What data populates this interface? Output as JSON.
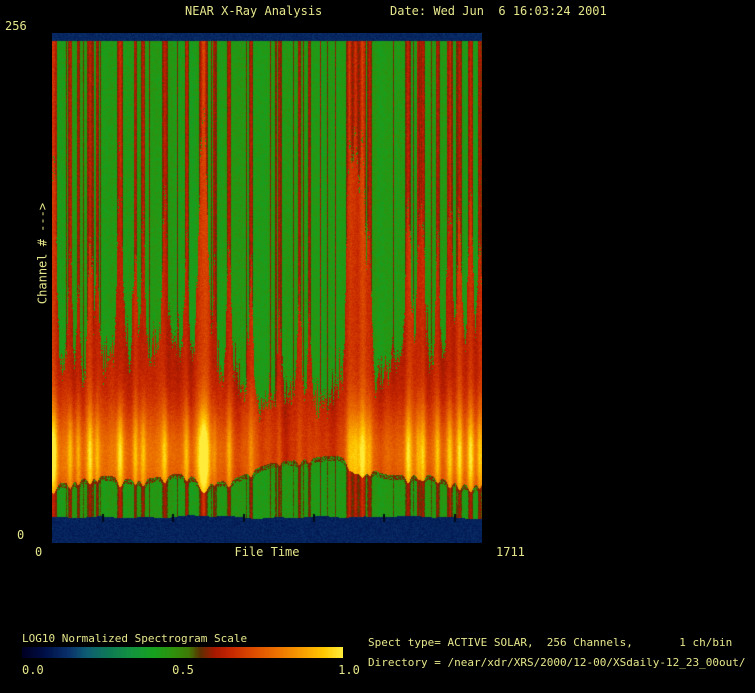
{
  "header": {
    "title": "NEAR X-Ray Analysis",
    "date": "Date: Wed Jun  6 16:03:24 2001"
  },
  "plot": {
    "y_axis": {
      "label": "Channel # --->",
      "max_tick": "256",
      "min_tick": "0"
    },
    "x_axis": {
      "label": "File Time",
      "min_tick": "0",
      "max_tick": "1711"
    }
  },
  "colorbar": {
    "title": "LOG10 Normalized Spectrogram Scale",
    "tick_labels": [
      "0.0",
      "0.5",
      "1.0"
    ]
  },
  "info": {
    "line1": "Spect type= ACTIVE SOLAR,  256 Channels,       1 ch/bin",
    "line2": "Directory = /near/xdr/XRS/2000/12-00/XSdaily-12_23_00out/"
  },
  "colors": {
    "background": "#000000",
    "text_yellow": "#e6e68c",
    "top_band_navy": "#0d2c5c",
    "quiet_green": "#1f9e1f",
    "band_red": "#cc2f00",
    "flare_yellow": "#ffec3a"
  },
  "chart_data": {
    "type": "heatmap",
    "title": "NEAR X-Ray Analysis",
    "xlabel": "File Time",
    "ylabel": "Channel #",
    "x_range": [
      0,
      1711
    ],
    "y_range": [
      0,
      256
    ],
    "scale": {
      "label": "LOG10 Normalized Spectrogram Scale",
      "range": [
        0.0,
        1.0
      ],
      "ticks": [
        0.0,
        0.5,
        1.0
      ]
    },
    "colormap_stops": [
      [
        0.0,
        "#000022"
      ],
      [
        0.07,
        "#001048"
      ],
      [
        0.14,
        "#0a2f6a"
      ],
      [
        0.2,
        "#0e5d74"
      ],
      [
        0.27,
        "#0e7a56"
      ],
      [
        0.34,
        "#139440"
      ],
      [
        0.41,
        "#16a11f"
      ],
      [
        0.47,
        "#2f930e"
      ],
      [
        0.52,
        "#3f7a06"
      ],
      [
        0.555,
        "#5c3000"
      ],
      [
        0.6,
        "#a81800"
      ],
      [
        0.65,
        "#c62600"
      ],
      [
        0.72,
        "#dd4d00"
      ],
      [
        0.8,
        "#ee7500"
      ],
      [
        0.88,
        "#f9a200"
      ],
      [
        0.94,
        "#ffc800"
      ],
      [
        1.0,
        "#ffec3a"
      ]
    ],
    "bands": {
      "top_blue_gap_channels": [
        252,
        256
      ],
      "quiet_background_channels": [
        90,
        252
      ],
      "active_emission_channels": [
        32,
        90
      ],
      "lower_quiet_channels": [
        13,
        32
      ],
      "bottom_blue_gap_channels": [
        0,
        13
      ],
      "peak_emission_channel": 44
    },
    "quiet_interval": {
      "center_time": 995,
      "sigma_time": 170
    },
    "flares": [
      {
        "time": 4,
        "strength": 0.8,
        "narrow_w": 1.8,
        "wide_w": 2.8
      },
      {
        "time": 71,
        "strength": 0.5,
        "narrow_w": 1.2,
        "wide_w": 2.0
      },
      {
        "time": 103,
        "strength": 0.38,
        "narrow_w": 1.0,
        "wide_w": 1.8
      },
      {
        "time": 150,
        "strength": 0.55,
        "narrow_w": 1.4,
        "wide_w": 2.2
      },
      {
        "time": 178,
        "strength": 0.42,
        "narrow_w": 1.0,
        "wide_w": 1.8
      },
      {
        "time": 269,
        "strength": 0.7,
        "narrow_w": 1.5,
        "wide_w": 2.4
      },
      {
        "time": 330,
        "strength": 0.4,
        "narrow_w": 1.0,
        "wide_w": 1.8
      },
      {
        "time": 361,
        "strength": 0.5,
        "narrow_w": 1.2,
        "wide_w": 2.0
      },
      {
        "time": 447,
        "strength": 0.55,
        "narrow_w": 1.3,
        "wide_w": 2.2
      },
      {
        "time": 534,
        "strength": 0.45,
        "narrow_w": 1.1,
        "wide_w": 1.9
      },
      {
        "time": 601,
        "strength": 1.0,
        "narrow_w": 2.0,
        "wide_w": 4.2
      },
      {
        "time": 645,
        "strength": 0.3,
        "narrow_w": 0.9,
        "wide_w": 1.6
      },
      {
        "time": 703,
        "strength": 0.5,
        "narrow_w": 1.2,
        "wide_w": 2.0
      },
      {
        "time": 790,
        "strength": 0.45,
        "narrow_w": 1.1,
        "wide_w": 1.9
      },
      {
        "time": 903,
        "strength": 0.3,
        "narrow_w": 0.9,
        "wide_w": 1.6
      },
      {
        "time": 982,
        "strength": 0.4,
        "narrow_w": 1.0,
        "wide_w": 1.8
      },
      {
        "time": 1022,
        "strength": 0.35,
        "narrow_w": 0.9,
        "wide_w": 1.7
      },
      {
        "time": 1182,
        "strength": 0.8,
        "narrow_w": 1.6,
        "wide_w": 2.8
      },
      {
        "time": 1206,
        "strength": 0.75,
        "narrow_w": 1.5,
        "wide_w": 2.5
      },
      {
        "time": 1233,
        "strength": 0.9,
        "narrow_w": 1.8,
        "wide_w": 3.0
      },
      {
        "time": 1262,
        "strength": 0.5,
        "narrow_w": 1.2,
        "wide_w": 2.0
      },
      {
        "time": 1415,
        "strength": 0.6,
        "narrow_w": 1.4,
        "wide_w": 2.3
      },
      {
        "time": 1455,
        "strength": 0.35,
        "narrow_w": 0.9,
        "wide_w": 1.7
      },
      {
        "time": 1474,
        "strength": 0.5,
        "narrow_w": 1.2,
        "wide_w": 2.0
      },
      {
        "time": 1533,
        "strength": 0.45,
        "narrow_w": 1.1,
        "wide_w": 1.9
      },
      {
        "time": 1581,
        "strength": 0.55,
        "narrow_w": 1.3,
        "wide_w": 2.1
      },
      {
        "time": 1620,
        "strength": 0.5,
        "narrow_w": 1.2,
        "wide_w": 2.0
      },
      {
        "time": 1664,
        "strength": 0.6,
        "narrow_w": 1.4,
        "wide_w": 2.3
      },
      {
        "time": 1700,
        "strength": 0.45,
        "narrow_w": 1.1,
        "wide_w": 1.9
      }
    ]
  }
}
